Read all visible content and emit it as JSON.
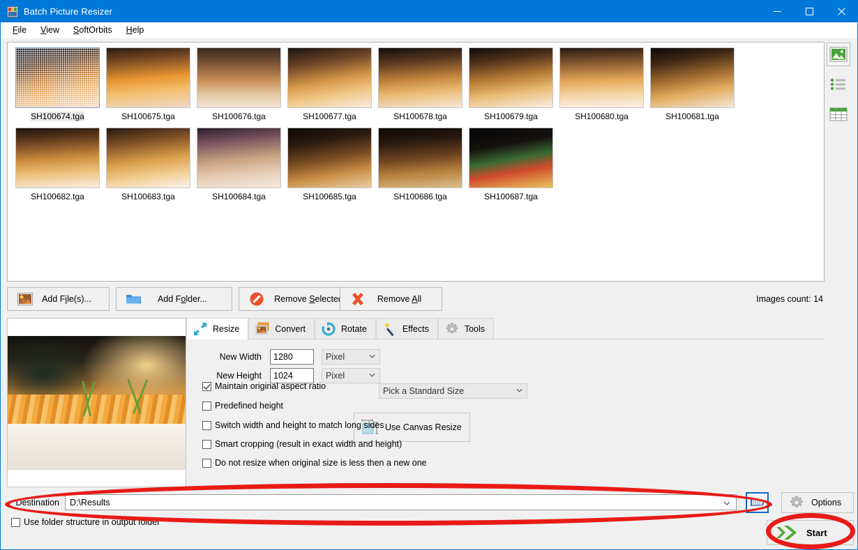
{
  "window": {
    "title": "Batch Picture Resizer",
    "icon": "app-icon",
    "minimize": "–",
    "maximize": "□",
    "close": "✕"
  },
  "menu": {
    "items": [
      {
        "label": "File",
        "accel": "F"
      },
      {
        "label": "View",
        "accel": "V"
      },
      {
        "label": "SoftOrbits",
        "accel": "S"
      },
      {
        "label": "Help",
        "accel": "H"
      }
    ]
  },
  "thumbnails": {
    "items": [
      {
        "name": "SH100674.tga",
        "selected": true
      },
      {
        "name": "SH100675.tga",
        "selected": false
      },
      {
        "name": "SH100676.tga",
        "selected": false
      },
      {
        "name": "SH100677.tga",
        "selected": false
      },
      {
        "name": "SH100678.tga",
        "selected": false
      },
      {
        "name": "SH100679.tga",
        "selected": false
      },
      {
        "name": "SH100680.tga",
        "selected": false
      },
      {
        "name": "SH100681.tga",
        "selected": false
      },
      {
        "name": "SH100682.tga",
        "selected": false
      },
      {
        "name": "SH100683.tga",
        "selected": false
      },
      {
        "name": "SH100684.tga",
        "selected": false
      },
      {
        "name": "SH100685.tga",
        "selected": false
      },
      {
        "name": "SH100686.tga",
        "selected": false
      },
      {
        "name": "SH100687.tga",
        "selected": false
      }
    ]
  },
  "view_modes": [
    {
      "icon": "thumbnail-view-icon",
      "active": true
    },
    {
      "icon": "list-view-icon",
      "active": false
    },
    {
      "icon": "details-grid-view-icon",
      "active": false
    }
  ],
  "file_toolbar": {
    "add_files": "Add File(s)...",
    "add_folder": "Add Folder...",
    "remove_selected": "Remove Selected",
    "remove_all": "Remove All",
    "images_count": "Images count: 14"
  },
  "tabs": [
    {
      "label": "Resize",
      "icon": "resize-arrows-icon",
      "active": true
    },
    {
      "label": "Convert",
      "icon": "convert-images-icon",
      "active": false
    },
    {
      "label": "Rotate",
      "icon": "rotate-circle-icon",
      "active": false
    },
    {
      "label": "Effects",
      "icon": "magic-wand-icon",
      "active": false
    },
    {
      "label": "Tools",
      "icon": "gear-icon",
      "active": false
    }
  ],
  "resize_tab": {
    "new_width_label": "New Width",
    "new_width_value": "1280",
    "new_width_unit": "Pixel",
    "new_height_label": "New Height",
    "new_height_value": "1024",
    "new_height_unit": "Pixel",
    "standard_size": "Pick a Standard Size",
    "canvas_resize": "Use Canvas Resize",
    "checkboxes": [
      {
        "label": "Maintain original aspect ratio",
        "checked": true
      },
      {
        "label": "Predefined height",
        "checked": false
      },
      {
        "label": "Switch width and height to match long sides",
        "checked": false
      },
      {
        "label": "Smart cropping (result in exact width and height)",
        "checked": false
      },
      {
        "label": "Do not resize when original size is less then a new one",
        "checked": false
      }
    ]
  },
  "destination": {
    "label": "Destination",
    "value": "D:\\Results",
    "browse_icon": "browse-folder-icon",
    "use_folder_structure": "Use folder structure in output folder",
    "use_folder_structure_checked": false
  },
  "actions": {
    "options": "Options",
    "start": "Start"
  },
  "colors": {
    "titlebar": "#0078d7",
    "annotation": "#e81b17",
    "panel": "#f0f0f0",
    "accent_green": "#55a630"
  }
}
